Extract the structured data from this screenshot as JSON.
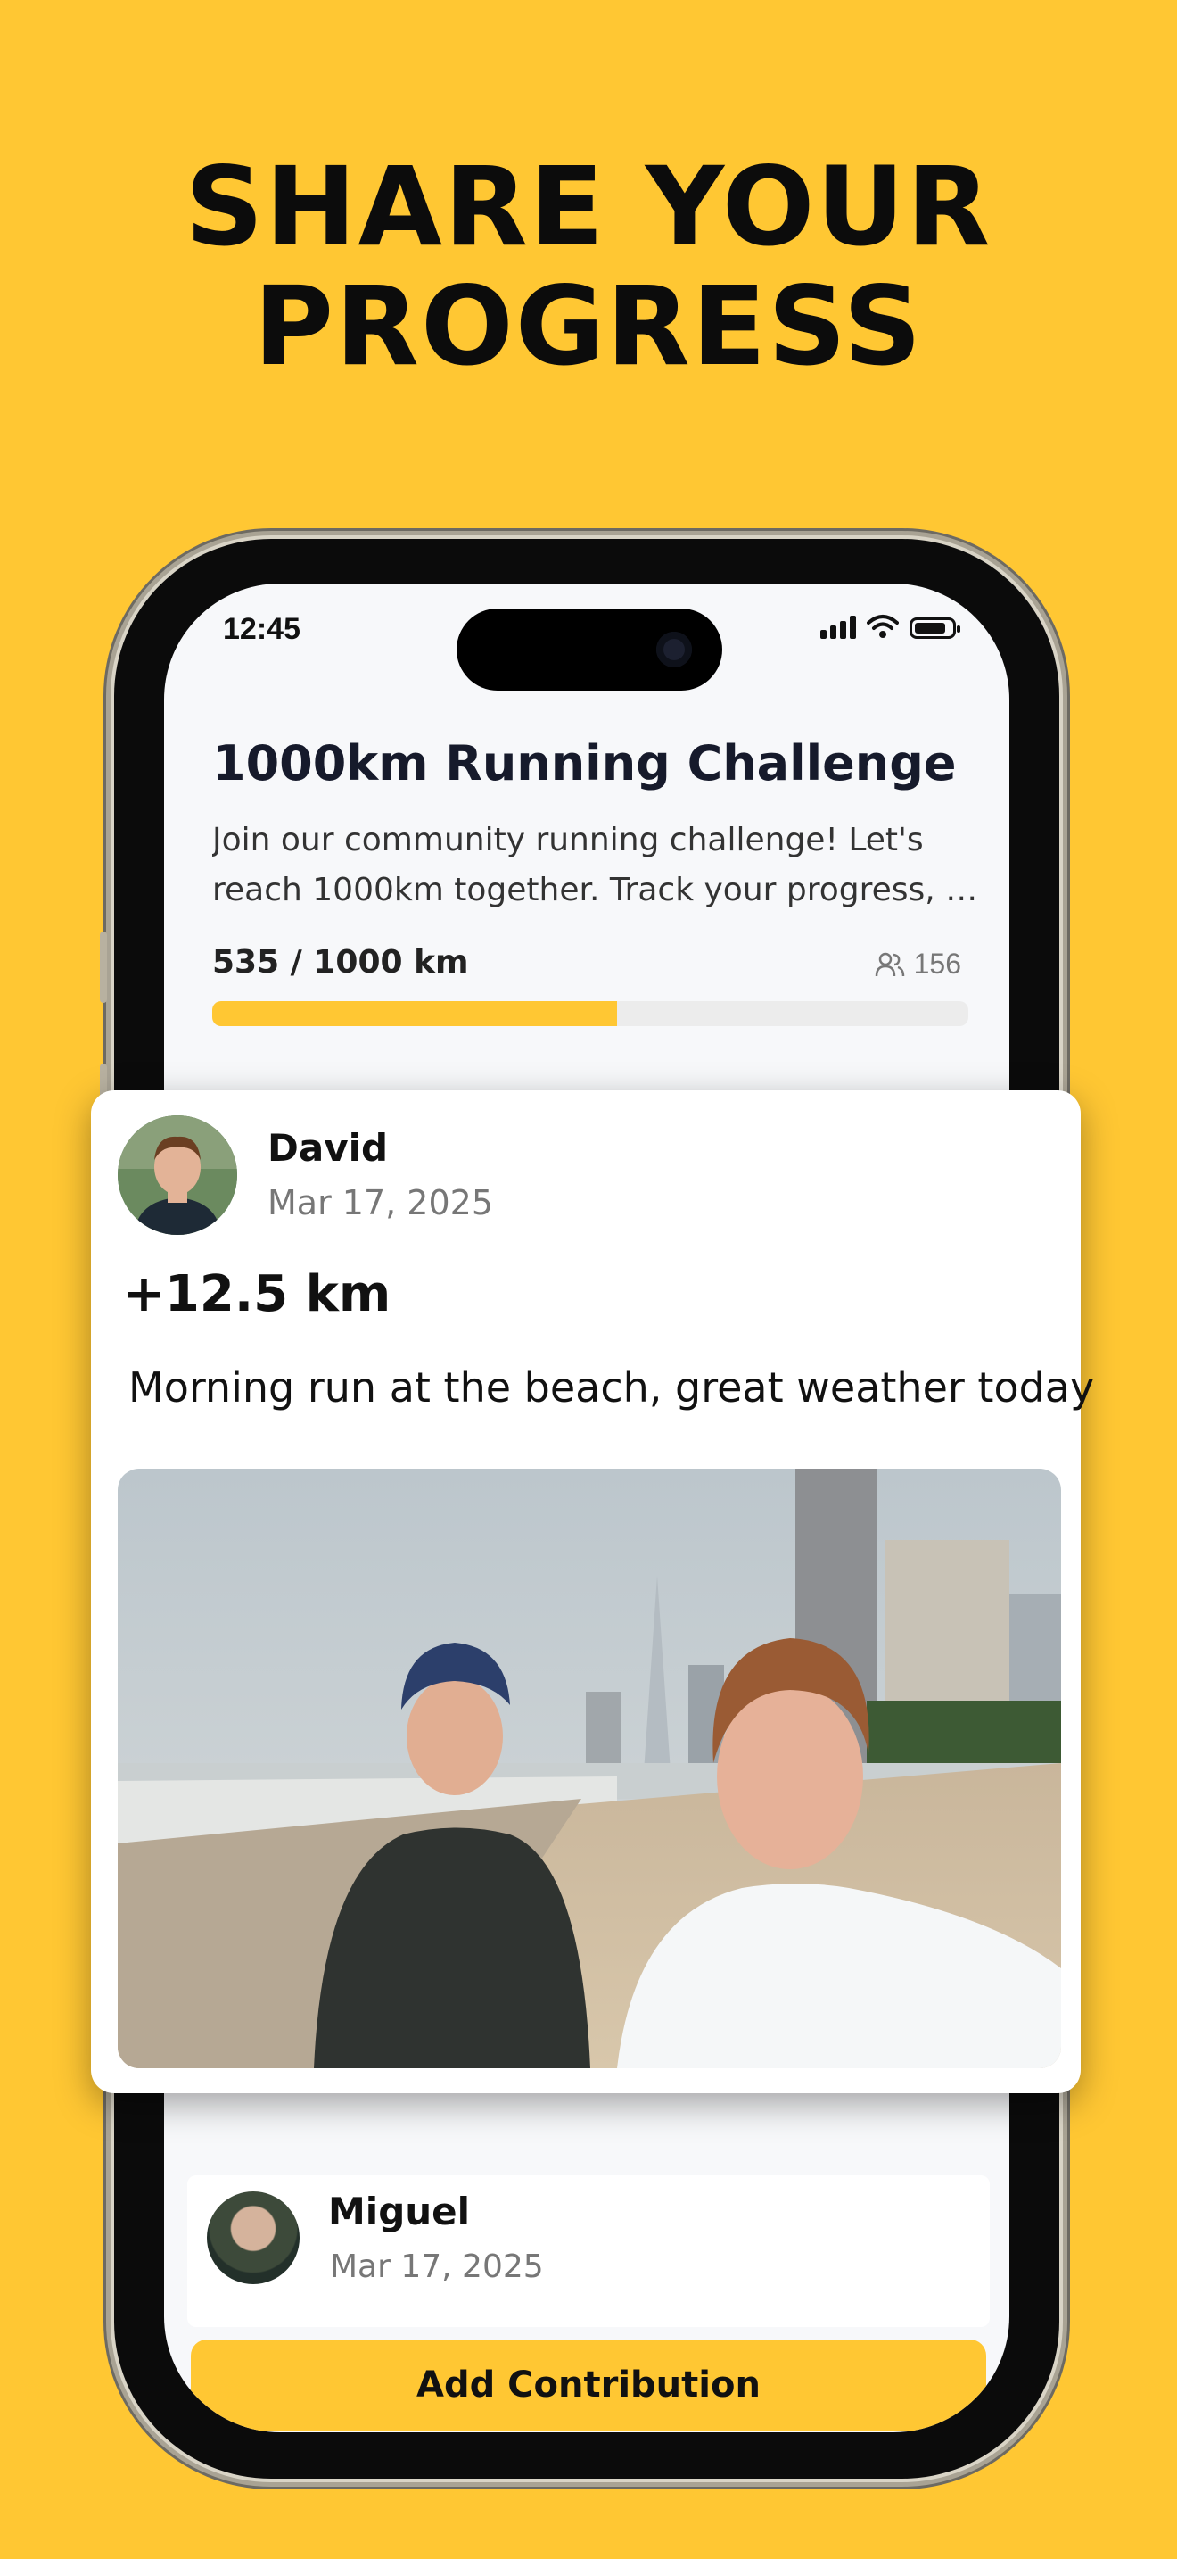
{
  "headline": {
    "line1": "SHARE YOUR",
    "line2": "PROGRESS"
  },
  "status_bar": {
    "time": "12:45"
  },
  "challenge": {
    "title": "1000km Running Challenge",
    "description_line1": "Join our community running challenge! Let's",
    "description_line2": "reach 1000km together. Track your progress, s...",
    "progress_label": "535 / 1000 km",
    "progress_value": 535,
    "progress_goal": 1000,
    "progress_fraction": 0.535,
    "participants": "156"
  },
  "featured_post": {
    "author": "David",
    "date": "Mar 17, 2025",
    "distance": "+12.5 km",
    "caption": "Morning run at the beach, great weather today"
  },
  "next_post": {
    "author": "Miguel",
    "date": "Mar 17, 2025"
  },
  "actions": {
    "add_contribution_label": "Add Contribution"
  },
  "colors": {
    "accent": "#FFC733",
    "text_dark": "#161a2b",
    "muted": "#777777"
  },
  "icons": {
    "participants": "users-icon",
    "signal": "cellular-signal-icon",
    "wifi": "wifi-icon",
    "battery": "battery-icon"
  }
}
